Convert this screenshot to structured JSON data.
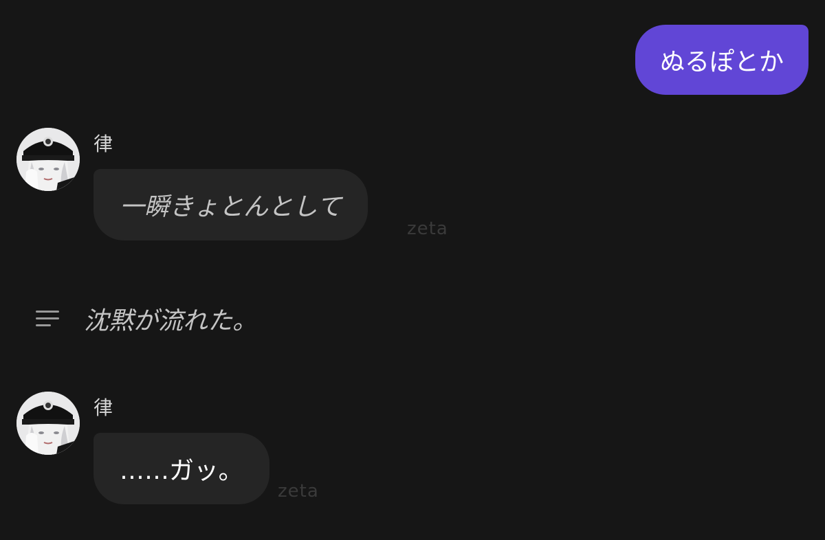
{
  "user_message": {
    "text": "ぬるぽとか",
    "bubble_color": "#6146d6"
  },
  "messages": [
    {
      "sender": "律",
      "avatar": "character-avatar",
      "text": "一瞬きょとんとして",
      "style": "italic",
      "watermark": "zeta"
    },
    {
      "sender": "律",
      "avatar": "character-avatar",
      "text": "……ガッ。",
      "style": "plain",
      "watermark": "zeta"
    }
  ],
  "narration": {
    "icon": "lines-icon",
    "text": "沈黙が流れた。"
  },
  "colors": {
    "background": "#161616",
    "bubble": "#252525",
    "accent": "#6146d6"
  }
}
